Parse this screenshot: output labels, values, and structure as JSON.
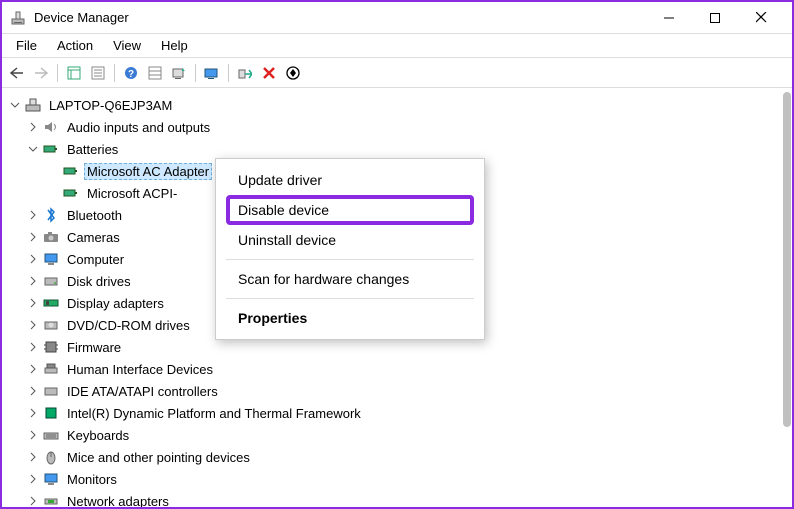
{
  "window": {
    "title": "Device Manager"
  },
  "menu": {
    "file": "File",
    "action": "Action",
    "view": "View",
    "help": "Help"
  },
  "toolbar_icons": {
    "back": "back-arrow-icon",
    "forward": "forward-arrow-icon",
    "show_hidden": "show-hidden-icon",
    "properties": "properties-list-icon",
    "help": "help-icon",
    "refresh": "refresh-icon",
    "scan": "scan-hardware-icon",
    "monitor1": "view-monitor-icon",
    "add_legacy": "add-legacy-icon",
    "remove": "remove-device-icon",
    "enable": "enable-device-icon"
  },
  "tree": {
    "root": "LAPTOP-Q6EJP3AM",
    "audio": "Audio inputs and outputs",
    "batteries": "Batteries",
    "bat_ac": "Microsoft AC Adapter",
    "bat_acpi": "Microsoft ACPI-",
    "bluetooth": "Bluetooth",
    "cameras": "Cameras",
    "computer": "Computer",
    "disk": "Disk drives",
    "display": "Display adapters",
    "dvd": "DVD/CD-ROM drives",
    "firmware": "Firmware",
    "hid": "Human Interface Devices",
    "ide": "IDE ATA/ATAPI controllers",
    "intel": "Intel(R) Dynamic Platform and Thermal Framework",
    "keyboards": "Keyboards",
    "mice": "Mice and other pointing devices",
    "monitors": "Monitors",
    "network": "Network adapters"
  },
  "context_menu": {
    "update": "Update driver",
    "disable": "Disable device",
    "uninstall": "Uninstall device",
    "scan": "Scan for hardware changes",
    "properties": "Properties"
  }
}
